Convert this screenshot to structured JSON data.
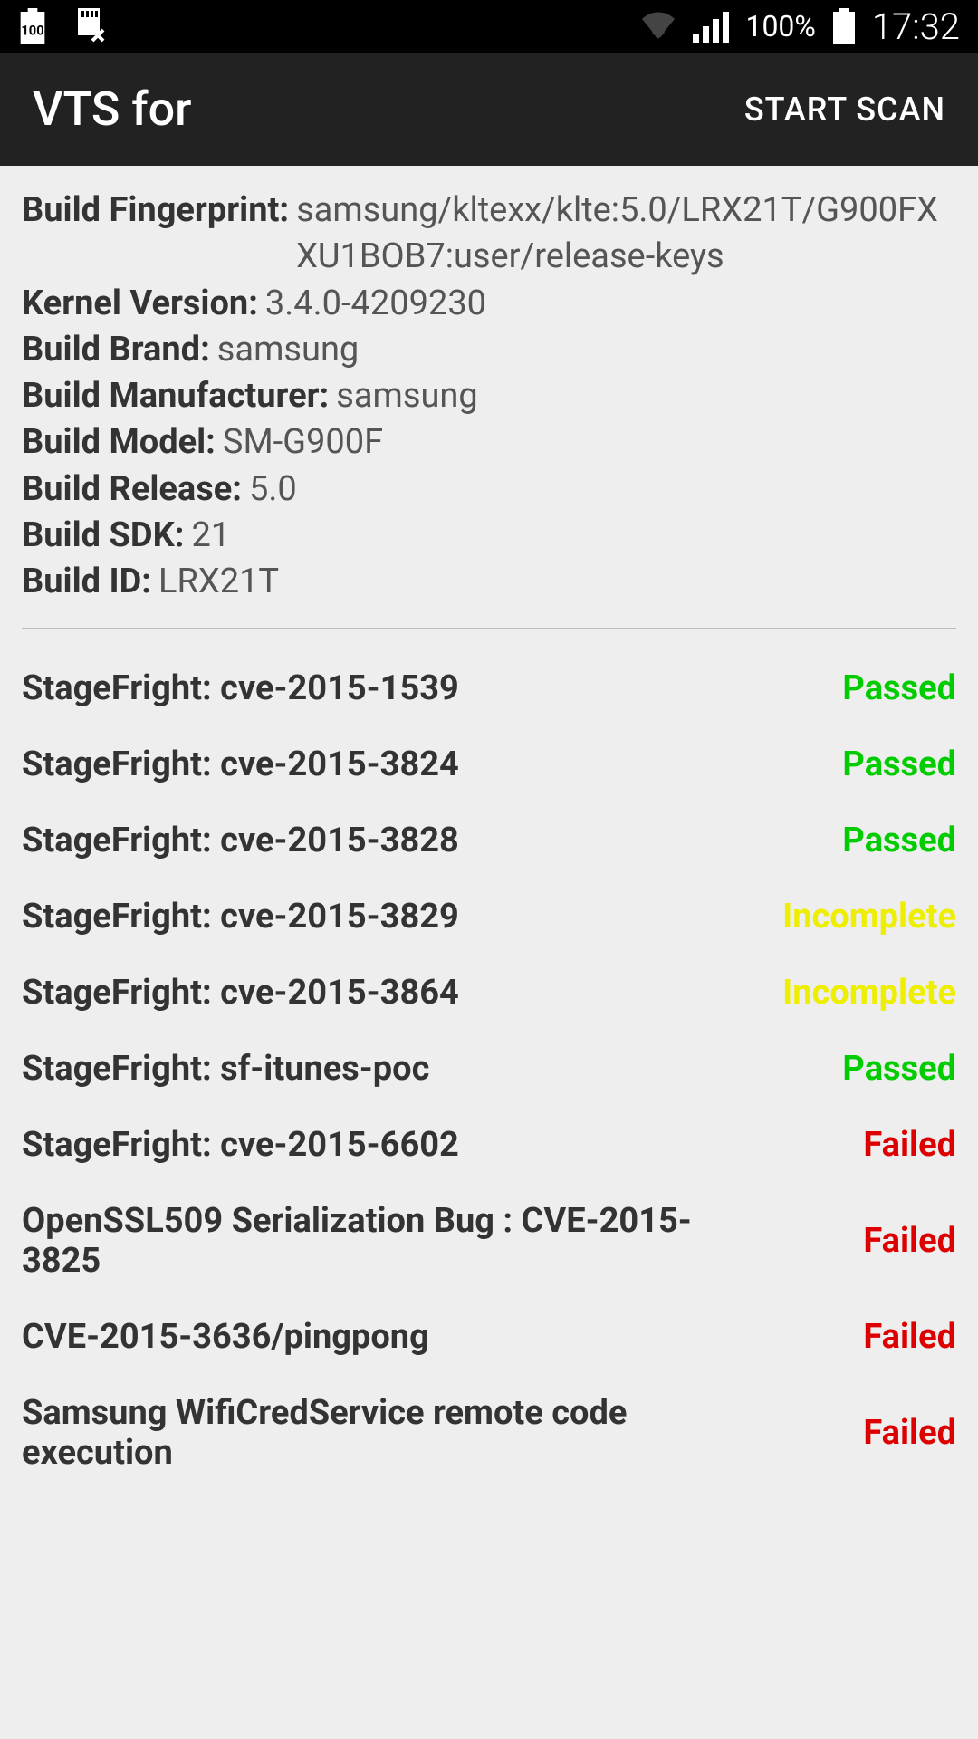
{
  "status_bar": {
    "battery_small_label": "100",
    "battery_percent": "100%",
    "clock": "17:32"
  },
  "action_bar": {
    "title": "VTS for",
    "scan_button": "START SCAN"
  },
  "device_info": [
    {
      "label": "Build Fingerprint:",
      "value": "samsung/kltexx/klte:5.0/LRX21T/G900FXXU1BOB7:user/release-keys"
    },
    {
      "label": "Kernel Version:",
      "value": "3.4.0-4209230"
    },
    {
      "label": "Build Brand:",
      "value": "samsung"
    },
    {
      "label": "Build Manufacturer:",
      "value": "samsung"
    },
    {
      "label": "Build Model:",
      "value": "SM-G900F"
    },
    {
      "label": "Build Release:",
      "value": "5.0"
    },
    {
      "label": "Build SDK:",
      "value": "21"
    },
    {
      "label": "Build ID:",
      "value": "LRX21T"
    }
  ],
  "tests": [
    {
      "name": "StageFright: cve-2015-1539",
      "status": "Passed",
      "status_class": "status-passed"
    },
    {
      "name": "StageFright: cve-2015-3824",
      "status": "Passed",
      "status_class": "status-passed"
    },
    {
      "name": "StageFright: cve-2015-3828",
      "status": "Passed",
      "status_class": "status-passed"
    },
    {
      "name": "StageFright: cve-2015-3829",
      "status": "Incomplete",
      "status_class": "status-incomplete"
    },
    {
      "name": "StageFright: cve-2015-3864",
      "status": "Incomplete",
      "status_class": "status-incomplete"
    },
    {
      "name": "StageFright: sf-itunes-poc",
      "status": "Passed",
      "status_class": "status-passed"
    },
    {
      "name": "StageFright: cve-2015-6602",
      "status": "Failed",
      "status_class": "status-failed"
    },
    {
      "name": "OpenSSL509 Serialization Bug : CVE-2015-3825",
      "status": "Failed",
      "status_class": "status-failed"
    },
    {
      "name": "CVE-2015-3636/pingpong",
      "status": "Failed",
      "status_class": "status-failed"
    },
    {
      "name": "Samsung WifiCredService remote code execution",
      "status": "Failed",
      "status_class": "status-failed"
    }
  ]
}
